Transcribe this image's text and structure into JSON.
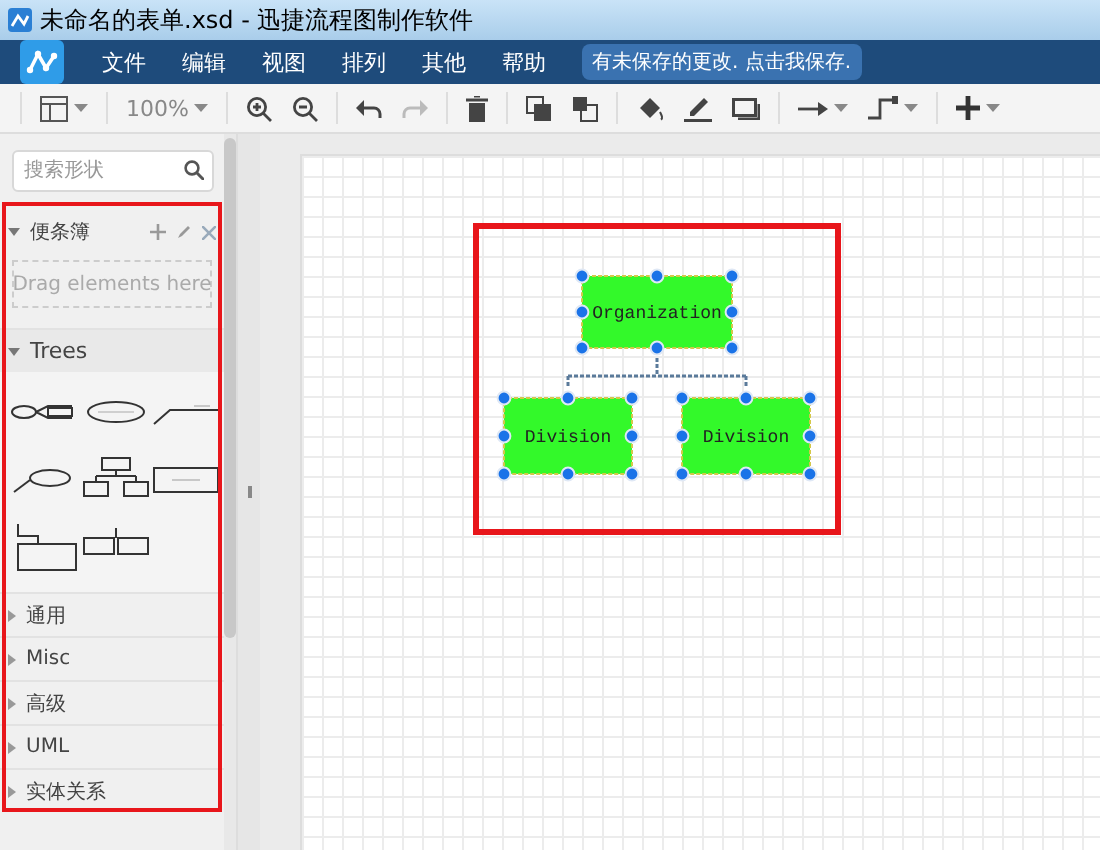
{
  "window": {
    "title": "未命名的表单.xsd - 迅捷流程图制作软件"
  },
  "menu": {
    "items": [
      "文件",
      "编辑",
      "视图",
      "排列",
      "其他",
      "帮助"
    ],
    "notice": "有未保存的更改. 点击我保存."
  },
  "toolbar": {
    "zoom": "100%"
  },
  "sidebar": {
    "search": {
      "placeholder": "搜索形状"
    },
    "scratchpad": {
      "title": "便条簿",
      "hint": "Drag elements here"
    },
    "sections": [
      {
        "label": "Trees",
        "expanded": true
      },
      {
        "label": "通用",
        "expanded": false
      },
      {
        "label": "Misc",
        "expanded": false
      },
      {
        "label": "高级",
        "expanded": false
      },
      {
        "label": "UML",
        "expanded": false
      },
      {
        "label": "实体关系",
        "expanded": false
      }
    ]
  },
  "diagram": {
    "root": {
      "label": "Organization",
      "selected": true
    },
    "children": [
      {
        "label": "Division",
        "selected": true
      },
      {
        "label": "Division",
        "selected": true
      }
    ]
  }
}
